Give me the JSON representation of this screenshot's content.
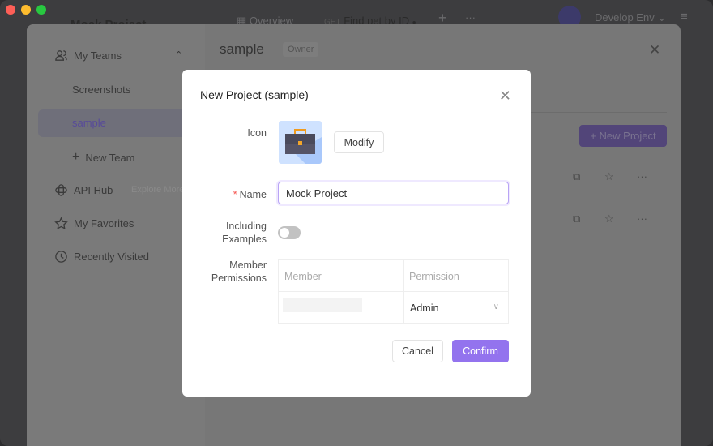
{
  "titlebar": {
    "project_tab": "Mock Project",
    "overview_tab": "Overview",
    "api_method": "GET",
    "api_tab": "Find pet by ID",
    "environment": "Develop Env"
  },
  "colors": {
    "accent": "#9373ee",
    "close_red": "#fe5f57",
    "minimize_yellow": "#febc2e",
    "maximize_green": "#28c840"
  },
  "sidebar": {
    "my_teams": "My Teams",
    "teams": [
      "Screenshots",
      "sample"
    ],
    "selected_team": "sample",
    "new_team": "New Team",
    "api_hub": "API Hub",
    "explore_more": "Explore More",
    "my_favorites": "My Favorites",
    "recently_visited": "Recently Visited"
  },
  "team_panel": {
    "title": "sample",
    "role_badge": "Owner",
    "new_project": "+ New Project"
  },
  "dialog": {
    "title": "New Project (sample)",
    "icon_label": "Icon",
    "modify_button": "Modify",
    "name_label": "Name",
    "name_value": "Mock Project",
    "including_examples_label_1": "Including",
    "including_examples_label_2": "Examples",
    "including_examples_on": false,
    "member_permissions_label_1": "Member",
    "member_permissions_label_2": "Permissions",
    "table": {
      "col_member": "Member",
      "col_permission": "Permission",
      "rows": [
        {
          "permission": "Admin"
        }
      ]
    },
    "cancel": "Cancel",
    "confirm": "Confirm"
  }
}
